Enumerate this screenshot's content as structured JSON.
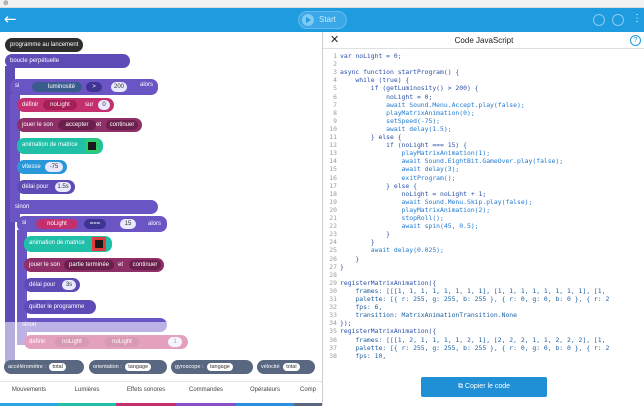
{
  "topbar": {
    "start_label": "Start"
  },
  "workspace": {
    "blocks": {
      "program_start": "programme au lancement",
      "forever": "boucle perpétuelle",
      "if": "si",
      "luminosity": "luminosité",
      "op_gt": ">",
      "val_200": "200",
      "then": "alors",
      "set": "définir",
      "var_nolight": "noLight",
      "to": "sur",
      "val_0": "0",
      "play_sound": "jouer le son",
      "sound_accept": "accepter",
      "and": "et",
      "continue": "continuer",
      "matrix_anim": "animation de matrice",
      "speed": "vitesse",
      "val_m75": "-75",
      "delay": "délai pour",
      "val_15s": "1.5s",
      "else": "sinon",
      "op_eq": "===",
      "val_15": "15",
      "sound_gameover": "partie terminée",
      "val_3s": "3s",
      "exit": "quitter le programme",
      "else2": "sinon",
      "val_1": "1"
    },
    "sensors": [
      {
        "label": "accéléromètre :",
        "value": "total"
      },
      {
        "label": "orientation :",
        "value": "tangage"
      },
      {
        "label": "gyroscope :",
        "value": "tangage"
      },
      {
        "label": "vélocité",
        "value": "total"
      }
    ],
    "tabs": [
      {
        "label": "Mouvements",
        "color": "#2aa7e3"
      },
      {
        "label": "Lumières",
        "color": "#1fbfa8"
      },
      {
        "label": "Effets sonores",
        "color": "#c4306e"
      },
      {
        "label": "Commandes",
        "color": "#8a4fc7"
      },
      {
        "label": "Opérateurs",
        "color": "#2c8ee0"
      },
      {
        "label": "Comp",
        "color": "#5a6780"
      }
    ]
  },
  "panel": {
    "title": "Code JavaScript",
    "copy_label": "Copier le code",
    "code_lines": [
      {
        "n": "1",
        "t": "var noLight = 0;"
      },
      {
        "n": "2",
        "t": ""
      },
      {
        "n": "3",
        "t": "async function startProgram() {"
      },
      {
        "n": "4",
        "t": "    while (true) {"
      },
      {
        "n": "5",
        "t": "        if (getLuminosity() > 200) {"
      },
      {
        "n": "6",
        "t": "            noLight = 0;"
      },
      {
        "n": "7",
        "t": "            await Sound.Menu.Accept.play(false);"
      },
      {
        "n": "8",
        "t": "            playMatrixAnimation(0);"
      },
      {
        "n": "9",
        "t": "            setSpeed(-75);"
      },
      {
        "n": "10",
        "t": "            await delay(1.5);"
      },
      {
        "n": "11",
        "t": "        } else {"
      },
      {
        "n": "12",
        "t": "            if (noLight === 15) {"
      },
      {
        "n": "13",
        "t": "                playMatrixAnimation(1);"
      },
      {
        "n": "14",
        "t": "                await Sound.EightBit.GameOver.play(false);"
      },
      {
        "n": "15",
        "t": "                await delay(3);"
      },
      {
        "n": "16",
        "t": "                exitProgram();"
      },
      {
        "n": "17",
        "t": "            } else {"
      },
      {
        "n": "18",
        "t": "                noLight = noLight + 1;"
      },
      {
        "n": "19",
        "t": "                await Sound.Menu.Skip.play(false);"
      },
      {
        "n": "20",
        "t": "                playMatrixAnimation(2);"
      },
      {
        "n": "21",
        "t": "                stopRoll();"
      },
      {
        "n": "22",
        "t": "                await spin(45, 0.5);"
      },
      {
        "n": "23",
        "t": "            }"
      },
      {
        "n": "24",
        "t": "        }"
      },
      {
        "n": "25",
        "t": "        await delay(0.025);"
      },
      {
        "n": "26",
        "t": "    }"
      },
      {
        "n": "27",
        "t": "}"
      },
      {
        "n": "28",
        "t": ""
      },
      {
        "n": "29",
        "t": "registerMatrixAnimation({"
      },
      {
        "n": "30",
        "t": "    frames: [[[1, 1, 1, 1, 1, 1, 1, 1], [1, 1, 1, 1, 1, 1, 1, 1], [1,"
      },
      {
        "n": "31",
        "t": "    palette: [{ r: 255, g: 255, b: 255 }, { r: 0, g: 0, b: 0 }, { r: 2"
      },
      {
        "n": "32",
        "t": "    fps: 6,"
      },
      {
        "n": "33",
        "t": "    transition: MatrixAnimationTransition.None"
      },
      {
        "n": "34",
        "t": "});"
      },
      {
        "n": "35",
        "t": "registerMatrixAnimation({"
      },
      {
        "n": "36",
        "t": "    frames: [[[1, 2, 1, 1, 1, 1, 2, 1], [2, 2, 2, 1, 1, 2, 2, 2], [1,"
      },
      {
        "n": "37",
        "t": "    palette: [{ r: 255, g: 255, b: 255 }, { r: 0, g: 0, b: 0 }, { r: 2"
      },
      {
        "n": "38",
        "t": "    fps: 10,"
      }
    ]
  }
}
